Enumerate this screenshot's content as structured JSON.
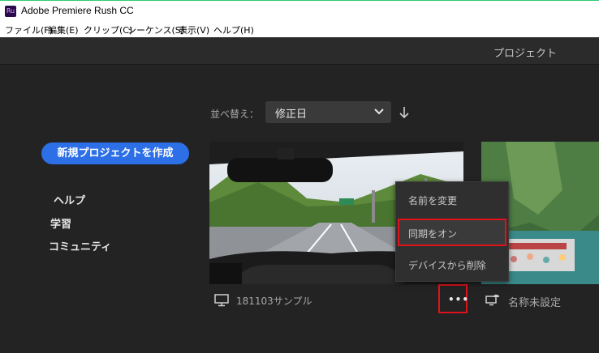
{
  "window": {
    "title": "Adobe Premiere Rush CC",
    "app_icon_text": "Ru"
  },
  "menubar": [
    "ファイル(F)",
    "編集(E)",
    "クリップ(C)",
    "シーケンス(S)",
    "表示(V)",
    "ヘルプ(H)"
  ],
  "header": {
    "title": "プロジェクト"
  },
  "sort": {
    "label": "並べ替え：",
    "value": "修正日",
    "direction_icon": "arrow-down-icon"
  },
  "sidebar": {
    "new_project": "新規プロジェクトを作成",
    "items": [
      "ヘルプ",
      "学習",
      "コミュニティ"
    ]
  },
  "projects": [
    {
      "name": "181103サンプル",
      "icon": "monitor-icon"
    },
    {
      "name": "名称未設定",
      "icon": "cloud-sync-icon"
    }
  ],
  "context_menu": {
    "items": [
      "名前を変更",
      "同期をオン",
      "デバイスから削除"
    ],
    "highlighted": "同期をオン"
  },
  "colors": {
    "accent": "#2c6fe6",
    "highlight": "#e0121b",
    "background": "#232323"
  }
}
